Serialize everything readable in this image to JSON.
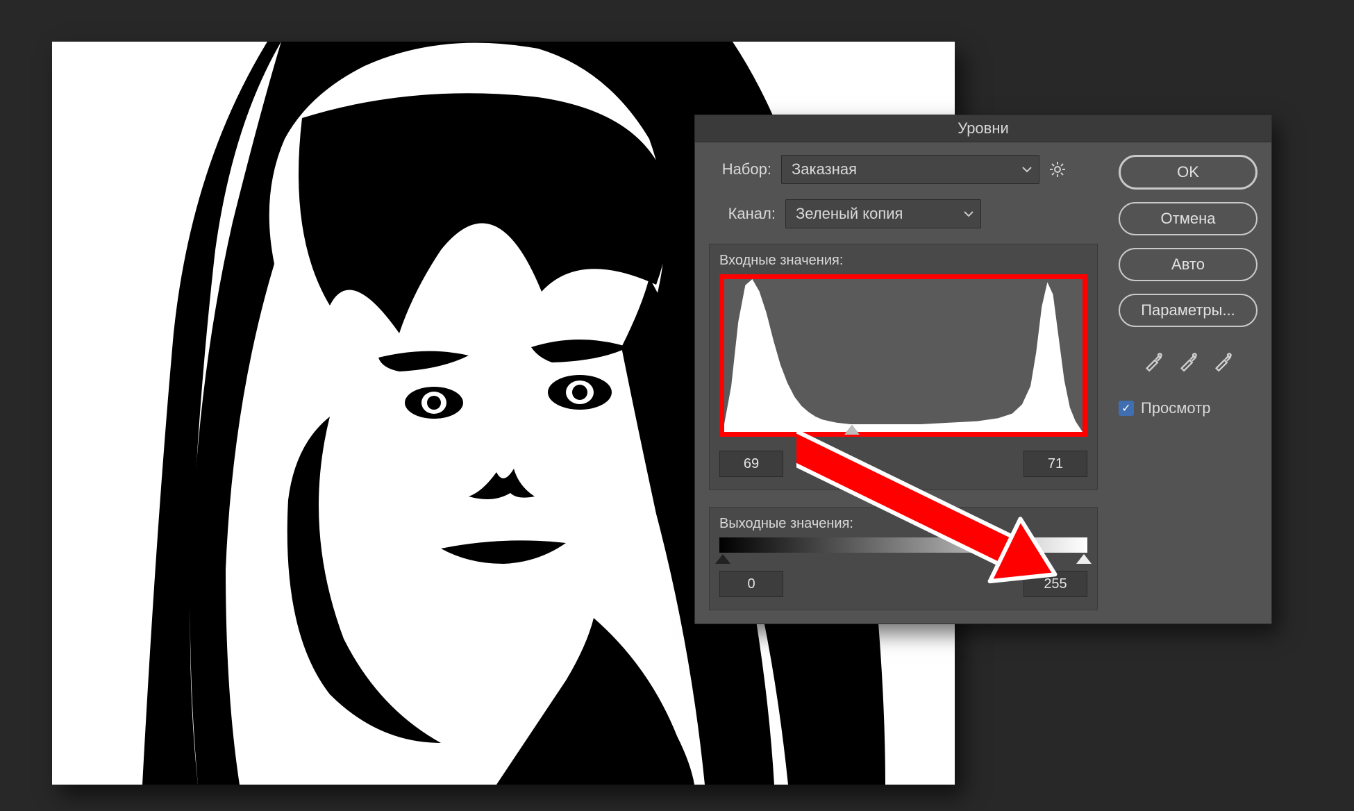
{
  "dialog": {
    "title": "Уровни",
    "preset_label": "Набор:",
    "preset_value": "Заказная",
    "channel_label": "Канал:",
    "channel_value": "Зеленый копия",
    "input_section": "Входные значения:",
    "input_black": "69",
    "input_white": "71",
    "output_section": "Выходные значения:",
    "output_black": "0",
    "output_white": "255"
  },
  "buttons": {
    "ok": "OK",
    "cancel": "Отмена",
    "auto": "Авто",
    "options": "Параметры..."
  },
  "preview": {
    "label": "Просмотр",
    "checked": true
  },
  "chart_data": {
    "type": "area",
    "title": "Histogram",
    "xlabel": "",
    "ylabel": "",
    "xlim": [
      0,
      255
    ],
    "ylim": [
      0,
      100
    ],
    "x": [
      0,
      5,
      10,
      15,
      20,
      25,
      30,
      35,
      40,
      45,
      50,
      55,
      60,
      65,
      70,
      75,
      80,
      90,
      100,
      120,
      140,
      160,
      180,
      195,
      205,
      212,
      218,
      222,
      226,
      230,
      234,
      238,
      242,
      246,
      250,
      255
    ],
    "values": [
      5,
      30,
      72,
      96,
      100,
      92,
      78,
      60,
      44,
      32,
      23,
      17,
      13,
      10,
      8,
      7,
      6,
      5,
      5,
      5,
      5,
      6,
      7,
      9,
      12,
      18,
      30,
      52,
      82,
      98,
      90,
      62,
      34,
      16,
      7,
      0
    ]
  }
}
